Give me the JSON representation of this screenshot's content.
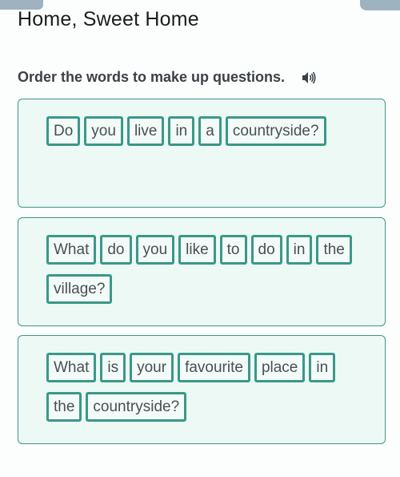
{
  "header": {
    "title": "Home, Sweet Home",
    "instruction": "Order the words to make up questions.",
    "audio_icon": "speaker-icon"
  },
  "colors": {
    "accent": "#3b9888",
    "panel_bg": "#ecf9f5",
    "tab": "#9eb2bf"
  },
  "questions": [
    {
      "words": [
        "Do",
        "you",
        "live",
        "in",
        "a",
        "countryside?"
      ]
    },
    {
      "words": [
        "What",
        "do",
        "you",
        "like",
        "to",
        "do",
        "in",
        "the",
        "village?"
      ]
    },
    {
      "words": [
        "What",
        "is",
        "your",
        "favourite",
        "place",
        "in",
        "the",
        "countryside?"
      ]
    }
  ]
}
